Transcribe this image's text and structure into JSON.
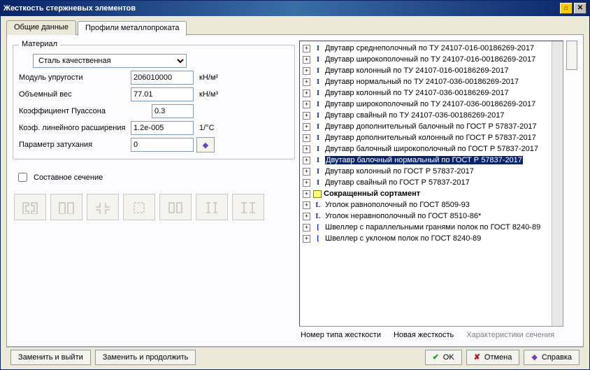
{
  "window": {
    "title": "Жесткость стержневых элементов"
  },
  "tabs": {
    "general": "Общие данные",
    "profiles": "Профили металлопроката"
  },
  "material": {
    "legend": "Материал",
    "steel": "Сталь качественная",
    "modulus_label": "Модуль упругости",
    "modulus_value": "206010000",
    "modulus_unit": "кН/м²",
    "density_label": "Объемный вес",
    "density_value": "77.01",
    "density_unit": "кН/м³",
    "poisson_label": "Коэффициент Пуассона",
    "poisson_value": "0.3",
    "thermal_label": "Коэф. линейного расширения",
    "thermal_value": "1.2e-005",
    "thermal_unit": "1/°C",
    "damping_label": "Параметр затухания",
    "damping_value": "0"
  },
  "composite": {
    "label": "Составное сечение",
    "checked": false
  },
  "tree": {
    "items": [
      {
        "icon": "ibeam",
        "text": "Двутавр среднеполочный по ТУ 24107-016-00186269-2017"
      },
      {
        "icon": "ibeam",
        "text": "Двутавр широкополочный по ТУ 24107-016-00186269-2017"
      },
      {
        "icon": "ibeam",
        "text": "Двутавр колонный по ТУ 24107-016-00186269-2017"
      },
      {
        "icon": "ibeam",
        "text": "Двутавр нормальный по ТУ 24107-036-00186269-2017"
      },
      {
        "icon": "ibeam",
        "text": "Двутавр колонный по ТУ 24107-036-00186269-2017"
      },
      {
        "icon": "ibeam",
        "text": "Двутавр широкополочный по ТУ 24107-036-00186269-2017"
      },
      {
        "icon": "ibeam",
        "text": "Двутавр свайный по ТУ 24107-036-00186269-2017"
      },
      {
        "icon": "ibeam",
        "text": "Двутавр дополнительный балочный по ГОСТ Р 57837-2017"
      },
      {
        "icon": "ibeam",
        "text": "Двутавр дополнительный колонный по ГОСТ Р 57837-2017"
      },
      {
        "icon": "ibeam",
        "text": "Двутавр балочный широкополочный по ГОСТ Р 57837-2017"
      },
      {
        "icon": "ibeam",
        "text": "Двутавр балочный нормальный по ГОСТ Р 57837-2017",
        "selected": true
      },
      {
        "icon": "ibeam",
        "text": "Двутавр колонный по ГОСТ Р 57837-2017"
      },
      {
        "icon": "ibeam",
        "text": "Двутавр свайный по ГОСТ Р 57837-2017"
      },
      {
        "icon": "group",
        "text": "Сокращенный сортамент",
        "bold": true
      },
      {
        "icon": "angle",
        "text": "Уголок равнополочный по ГОСТ 8509-93"
      },
      {
        "icon": "angle",
        "text": "Уголок неравнополочный по ГОСТ 8510-86*"
      },
      {
        "icon": "channel",
        "text": "Швеллер с параллельными гранями полок по ГОСТ 8240-89"
      },
      {
        "icon": "channel",
        "text": "Швеллер с уклоном полок по ГОСТ 8240-89"
      }
    ]
  },
  "under": {
    "type_label": "Номер типа жесткости",
    "new_label": "Новая жесткость",
    "chars_label": "Характеристики сечения"
  },
  "buttons": {
    "replace_exit": "Заменить и выйти",
    "replace_cont": "Заменить и продолжить",
    "ok": "OK",
    "cancel": "Отмена",
    "help": "Справка"
  }
}
